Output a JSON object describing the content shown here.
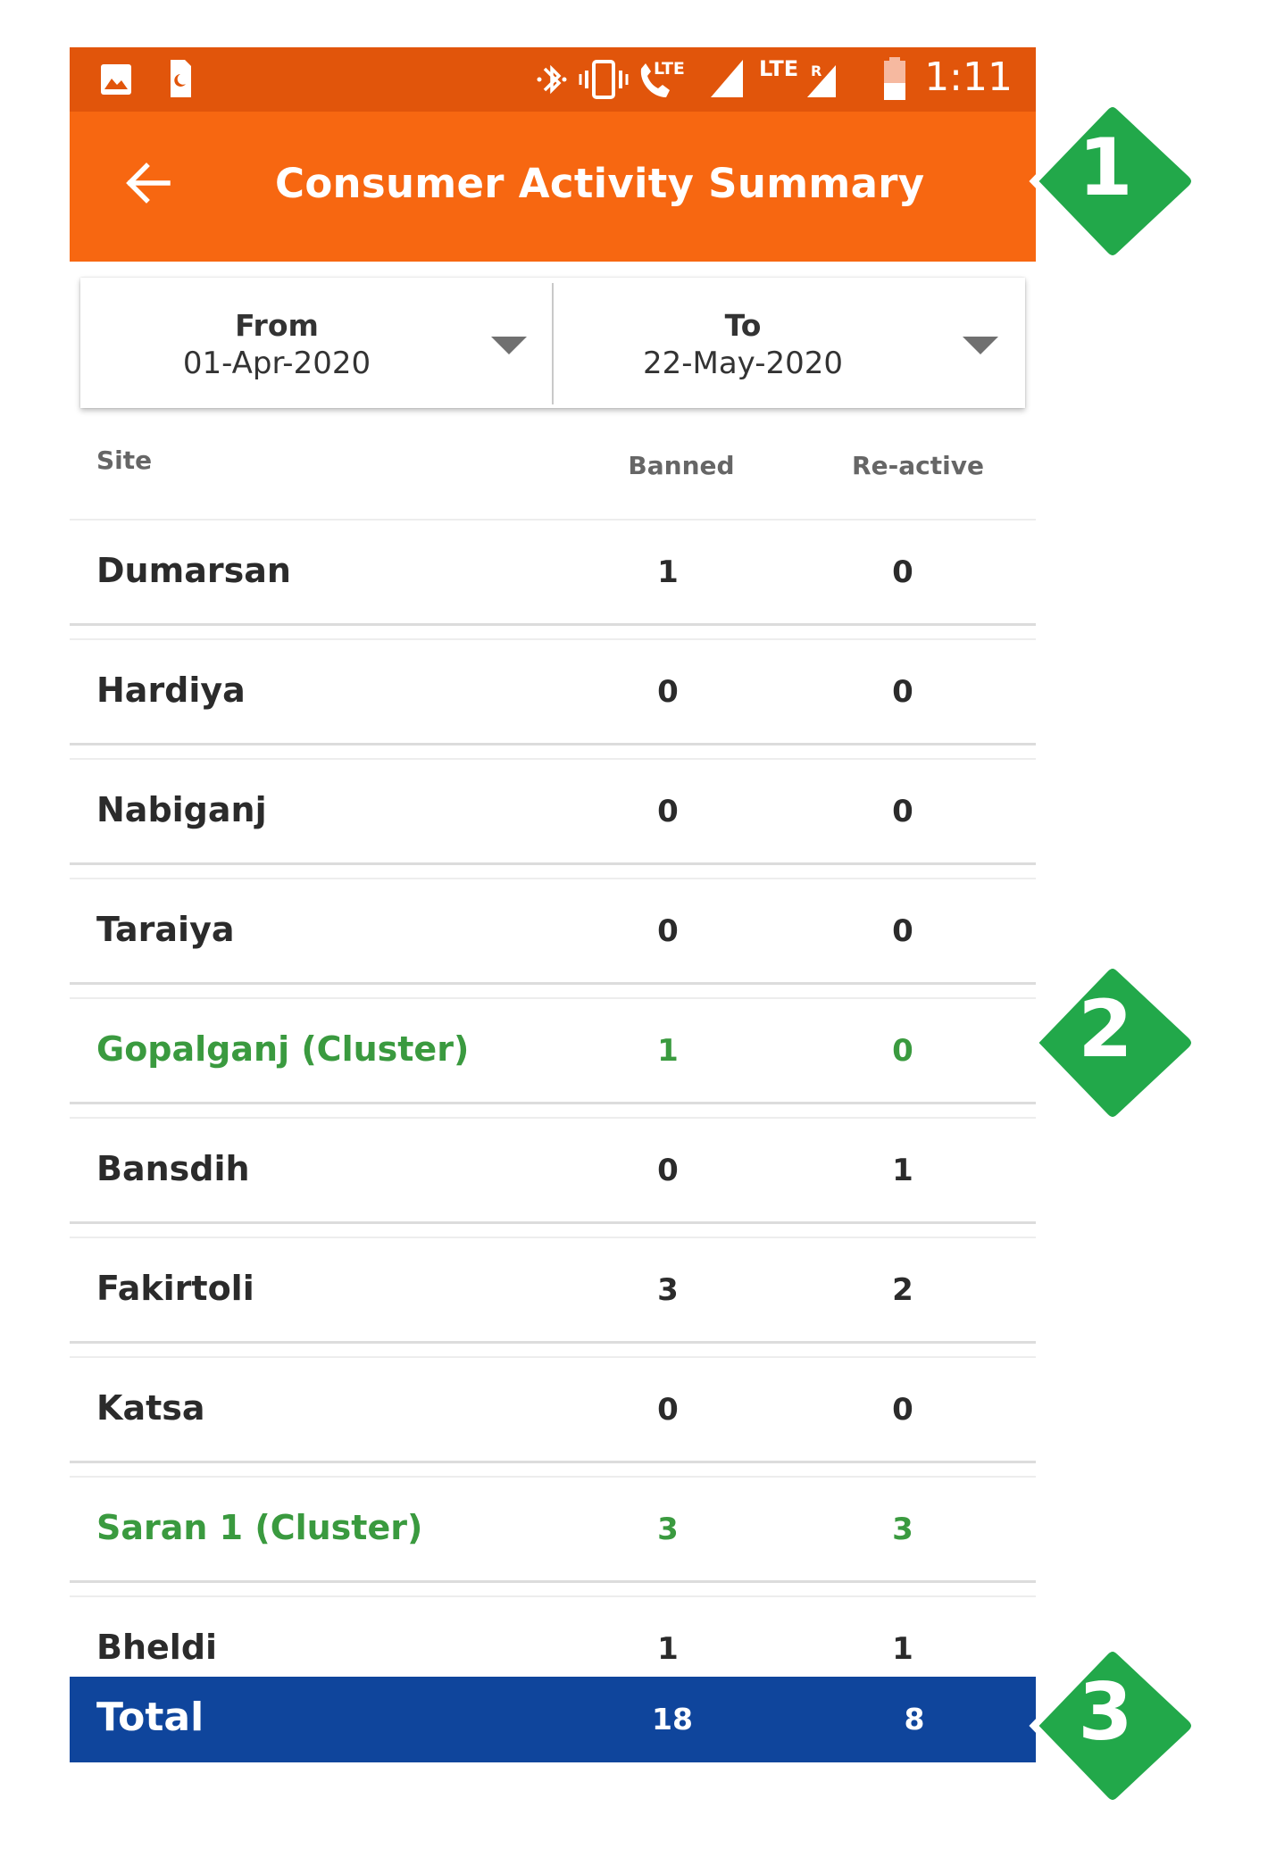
{
  "status_bar": {
    "time": "1:11",
    "icons": [
      "gallery-icon",
      "sim-icon",
      "bluetooth-icon",
      "vibrate-icon",
      "volte-call-icon",
      "signal-icon",
      "lte-roaming-signal-icon",
      "battery-icon"
    ],
    "lte_label": "LTE",
    "roaming_label": "R"
  },
  "app_bar": {
    "title": "Consumer Activity Summary",
    "back_icon": "arrow-left-icon",
    "color": "#f76711"
  },
  "date_range": {
    "from_label": "From",
    "from_value": "01-Apr-2020",
    "to_label": "To",
    "to_value": "22-May-2020"
  },
  "table": {
    "headers": {
      "site": "Site",
      "banned": "Banned",
      "reactive": "Re-active"
    },
    "rows": [
      {
        "site": "Dumarsan",
        "banned": "1",
        "reactive": "0",
        "cluster": false
      },
      {
        "site": "Hardiya",
        "banned": "0",
        "reactive": "0",
        "cluster": false
      },
      {
        "site": "Nabiganj",
        "banned": "0",
        "reactive": "0",
        "cluster": false
      },
      {
        "site": "Taraiya",
        "banned": "0",
        "reactive": "0",
        "cluster": false
      },
      {
        "site": "Gopalganj (Cluster)",
        "banned": "1",
        "reactive": "0",
        "cluster": true
      },
      {
        "site": "Bansdih",
        "banned": "0",
        "reactive": "1",
        "cluster": false
      },
      {
        "site": "Fakirtoli",
        "banned": "3",
        "reactive": "2",
        "cluster": false
      },
      {
        "site": "Katsa",
        "banned": "0",
        "reactive": "0",
        "cluster": false
      },
      {
        "site": "Saran 1 (Cluster)",
        "banned": "3",
        "reactive": "3",
        "cluster": true
      },
      {
        "site": "Bheldi",
        "banned": "1",
        "reactive": "1",
        "cluster": false
      }
    ],
    "cluster_color": "#3a9a3f"
  },
  "total": {
    "label": "Total",
    "banned": "18",
    "reactive": "8",
    "color": "#0f459c"
  },
  "callouts": [
    {
      "number": "1"
    },
    {
      "number": "2"
    },
    {
      "number": "3"
    }
  ],
  "callout_color": "#22a84a"
}
